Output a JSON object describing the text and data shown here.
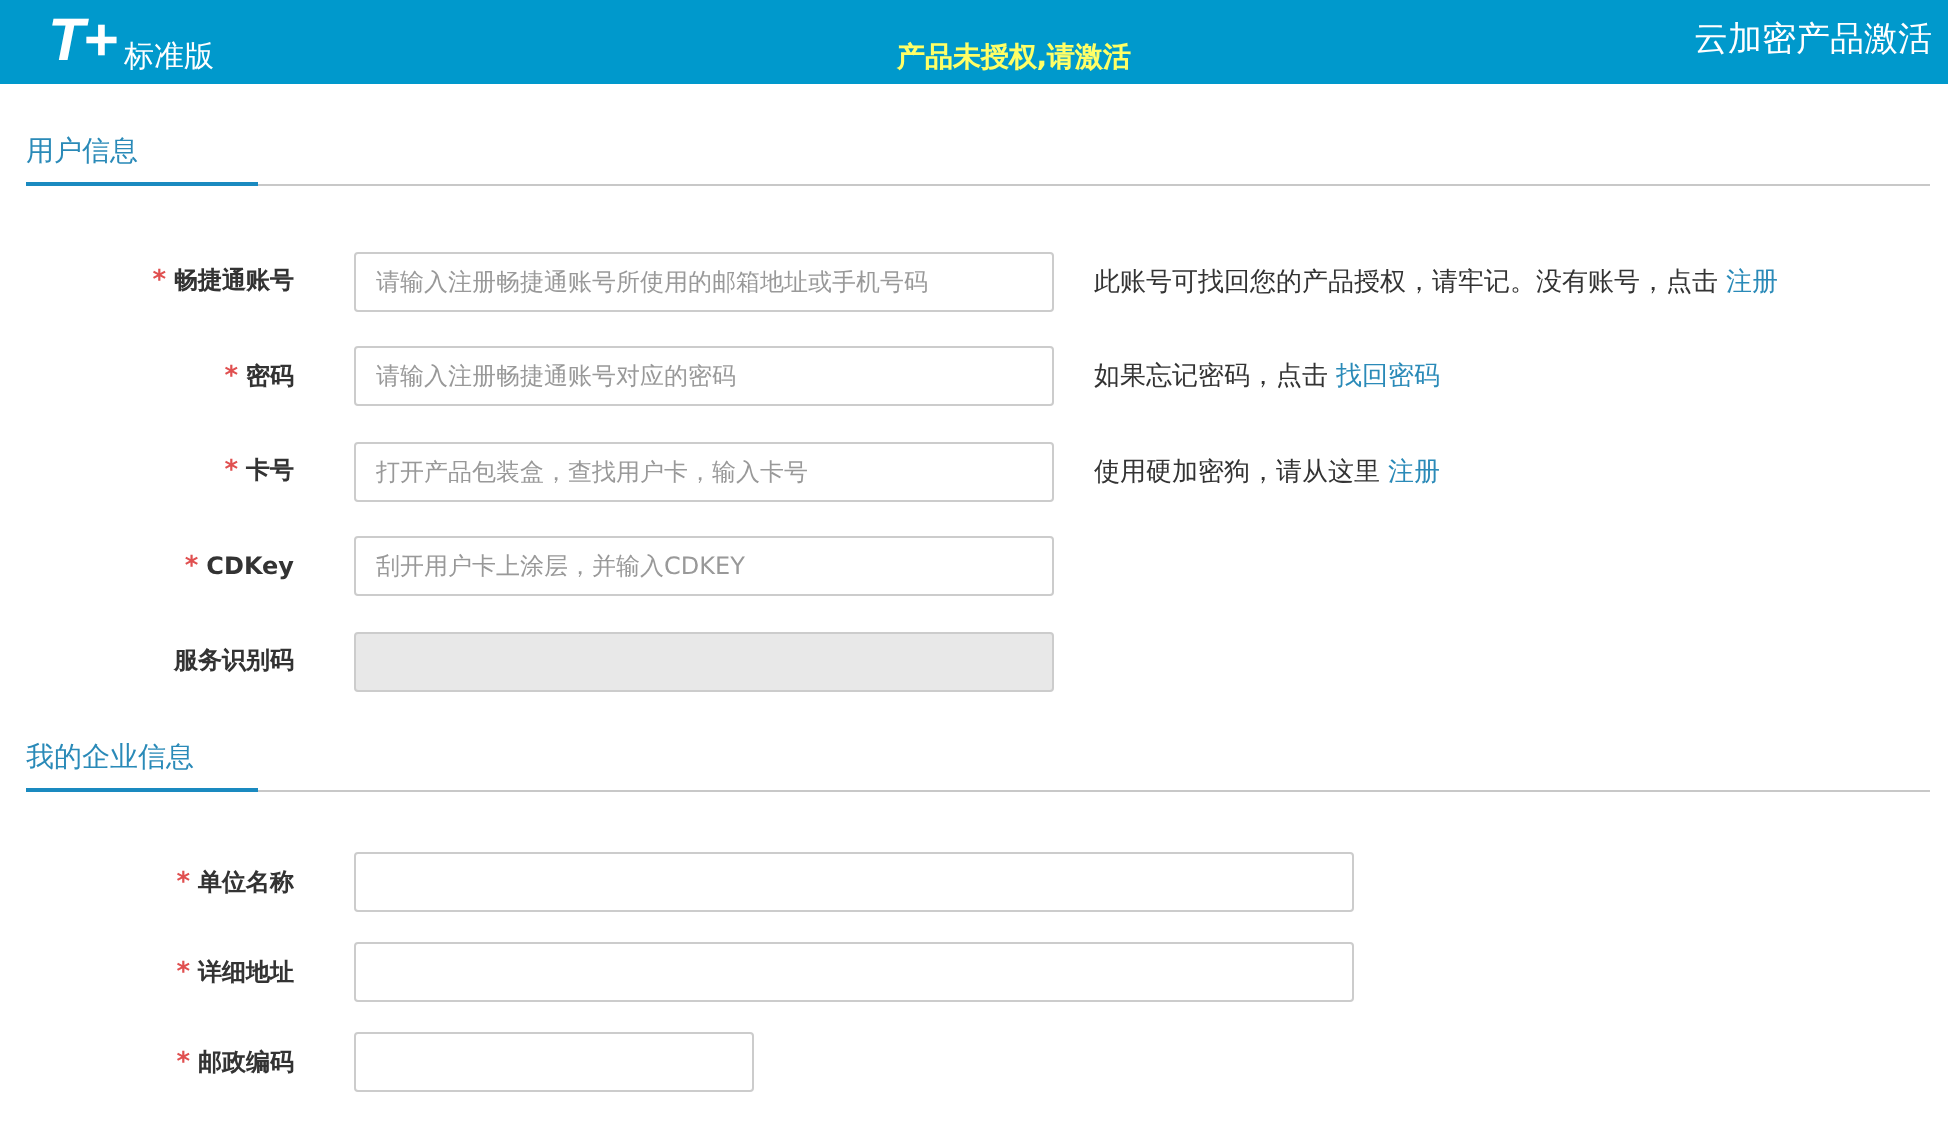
{
  "header": {
    "logo": "T+",
    "edition": "标准版",
    "notice": "产品未授权,请激活",
    "title": "云加密产品激活"
  },
  "sections": [
    {
      "title": "用户信息",
      "fields": [
        {
          "mark": "*",
          "label": "畅捷通账号",
          "placeholder": "请输入注册畅捷通账号所使用的邮箱地址或手机号码",
          "kind": "medium",
          "disabled": false,
          "hint": {
            "text": "此账号可找回您的产品授权，请牢记。没有账号，点击",
            "link": "注册"
          }
        },
        {
          "mark": "*",
          "label": "密码",
          "placeholder": "请输入注册畅捷通账号对应的密码",
          "kind": "medium",
          "disabled": false,
          "hint": {
            "text": "如果忘记密码，点击",
            "link": "找回密码"
          }
        },
        {
          "mark": "*",
          "label": "卡号",
          "placeholder": "打开产品包装盒，查找用户卡，输入卡号",
          "kind": "medium",
          "disabled": false,
          "hint": {
            "text": "使用硬加密狗，请从这里",
            "link": "注册"
          }
        },
        {
          "mark": "*",
          "label": "CDKey",
          "placeholder": "刮开用户卡上涂层，并输入CDKEY",
          "kind": "medium",
          "disabled": false
        },
        {
          "label": "服务识别码",
          "kind": "medium",
          "disabled": true
        }
      ]
    },
    {
      "title": "我的企业信息",
      "fields": [
        {
          "mark": "*",
          "label": "单位名称",
          "kind": "large",
          "disabled": false
        },
        {
          "mark": "*",
          "label": "详细地址",
          "kind": "large",
          "disabled": false
        },
        {
          "mark": "*",
          "label": "邮政编码",
          "kind": "small",
          "disabled": false
        }
      ]
    }
  ]
}
